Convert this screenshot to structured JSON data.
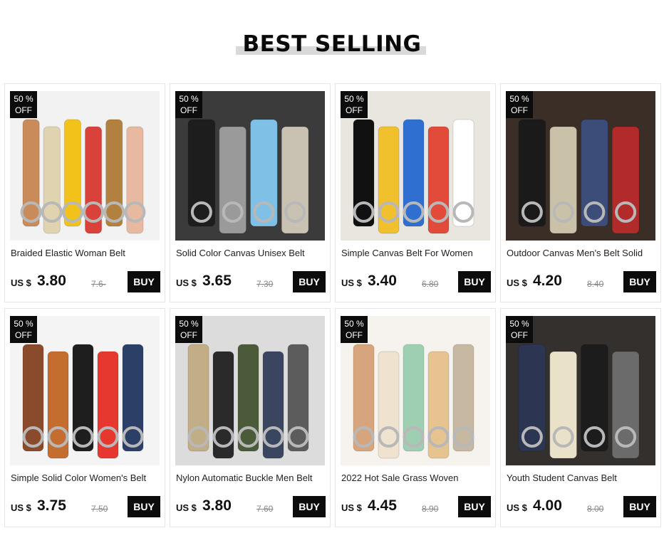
{
  "section": {
    "title": "BEST SELLING"
  },
  "products": [
    {
      "badge_pct": "50 %",
      "badge_off": "OFF",
      "name": "Braided Elastic Woman Belt",
      "currency": "US $",
      "price": "3.80",
      "original_price": "7.6-",
      "buy_label": "BUY",
      "image": "woven-round-buckle-belts",
      "bg": "#f2f2f2"
    },
    {
      "badge_pct": "50 %",
      "badge_off": "OFF",
      "name": "Solid Color Canvas Unisex Belt",
      "currency": "US $",
      "price": "3.65",
      "original_price": "7.30",
      "buy_label": "BUY",
      "image": "canvas-d-ring-belts",
      "bg": "#3b3b3b"
    },
    {
      "badge_pct": "50 %",
      "badge_off": "OFF",
      "name": "Simple Canvas Belt For Women",
      "currency": "US $",
      "price": "3.40",
      "original_price": "6.80",
      "buy_label": "BUY",
      "image": "checkered-canvas-belts",
      "bg": "#e9e6e0"
    },
    {
      "badge_pct": "50 %",
      "badge_off": "OFF",
      "name": "Outdoor Canvas Men's Belt Solid",
      "currency": "US $",
      "price": "4.20",
      "original_price": "8.40",
      "buy_label": "BUY",
      "image": "striped-pin-buckle-belts",
      "bg": "#3a2e26"
    },
    {
      "badge_pct": "50 %",
      "badge_off": "OFF",
      "name": "Simple Solid Color Women's Belt",
      "currency": "US $",
      "price": "3.75",
      "original_price": "7.50",
      "buy_label": "BUY",
      "image": "leather-round-buckle-belts",
      "bg": "#f4f4f4"
    },
    {
      "badge_pct": "50 %",
      "badge_off": "OFF",
      "name": "Nylon Automatic Buckle Men Belt",
      "currency": "US $",
      "price": "3.80",
      "original_price": "7.60",
      "buy_label": "BUY",
      "image": "nylon-automatic-buckle-belts",
      "bg": "#dcdcdc"
    },
    {
      "badge_pct": "50 %",
      "badge_off": "OFF",
      "name": "2022 Hot Sale Grass Woven",
      "currency": "US $",
      "price": "4.45",
      "original_price": "8.90",
      "buy_label": "BUY",
      "image": "grass-woven-belts",
      "bg": "#f6f3ee"
    },
    {
      "badge_pct": "50 %",
      "badge_off": "OFF",
      "name": "Youth Student Canvas Belt",
      "currency": "US $",
      "price": "4.00",
      "original_price": "8.00",
      "buy_label": "BUY",
      "image": "striped-student-belts",
      "bg": "#33302d"
    }
  ]
}
